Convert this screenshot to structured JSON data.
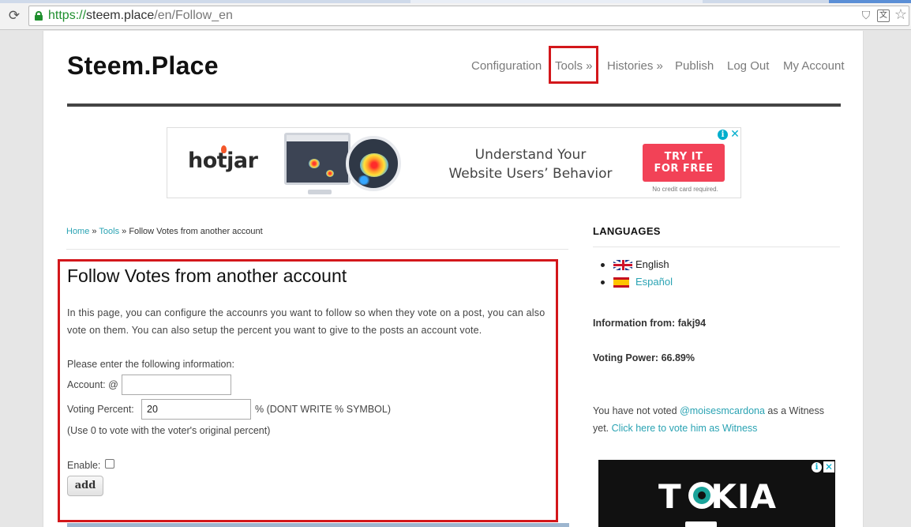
{
  "browser": {
    "url_scheme": "https://",
    "url_host": "steem.place",
    "url_path": "/en/Follow_en",
    "reload_glyph": "C",
    "icons": [
      "reload-icon",
      "lock-icon",
      "shield-icon",
      "translate-icon",
      "star-icon"
    ]
  },
  "site": {
    "title": "Steem.Place",
    "nav": [
      {
        "label": "Configuration"
      },
      {
        "label": "Tools »"
      },
      {
        "label": "Histories »"
      },
      {
        "label": "Publish"
      },
      {
        "label": "Log Out"
      },
      {
        "label": "My Account"
      }
    ]
  },
  "ad_banner": {
    "brand": "hotjar",
    "headline_line1": "Understand Your",
    "headline_line2": "Website Users’ Behavior",
    "cta_line1": "TRY IT",
    "cta_line2": "FOR FREE",
    "note": "No credit card required.",
    "accent_color": "#f24257"
  },
  "breadcrumb": {
    "home": "Home",
    "sep": "»",
    "tools": "Tools",
    "current": "Follow Votes from another account"
  },
  "main": {
    "title": "Follow Votes from another account",
    "description": "In this page, you can configure the accounrs you want to follow so when they vote on a post, you can also vote on them. You can also setup the percent you want to give to the posts an account vote.",
    "form": {
      "intro": "Please enter the following information:",
      "account_label": "Account: @",
      "account_value": "",
      "percent_label": "Voting Percent:",
      "percent_value": "20",
      "percent_suffix": "% (DONT WRITE % SYMBOL)",
      "percent_hint": "(Use 0 to vote with the voter's original percent)",
      "enable_label": "Enable:",
      "enable_checked": false,
      "submit_label": "add"
    }
  },
  "sidebar": {
    "languages_heading": "LANGUAGES",
    "languages": [
      {
        "label": "English",
        "flag": "uk-flag-icon"
      },
      {
        "label": "Español",
        "flag": "spain-flag-icon"
      }
    ],
    "info_from": "Information from: fakj94",
    "voting_power": "Voting Power: 66.89%",
    "witness_text_1": "You have not voted",
    "witness_user": "@moisesmcardona",
    "witness_text_2": "as a Witness yet.",
    "witness_link": "Click here to vote him as Witness",
    "ad_brand": "TOKIA"
  },
  "colors": {
    "link": "#2aa3b3",
    "highlight_box": "#d3171b"
  }
}
